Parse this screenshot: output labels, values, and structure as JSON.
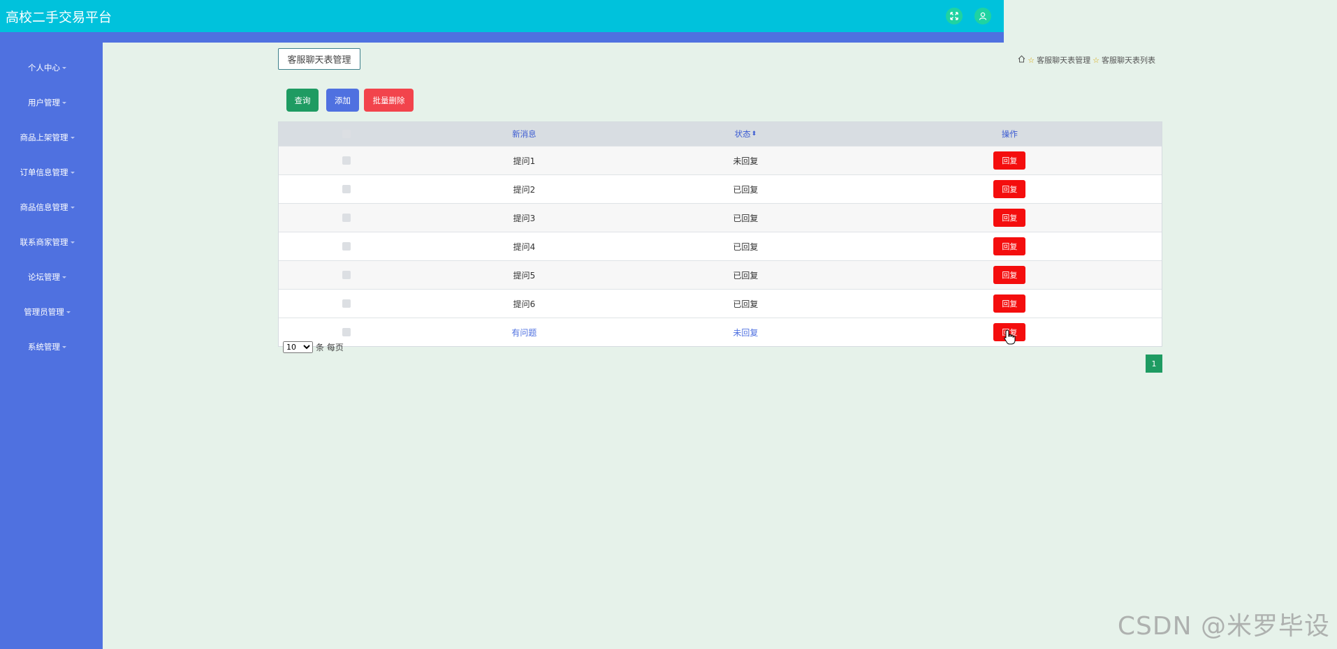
{
  "header": {
    "app_title": "高校二手交易平台",
    "icons": [
      "fullscreen-icon",
      "user-icon"
    ],
    "accent_color": "#00c2dc"
  },
  "sidebar": {
    "items": [
      {
        "label": "个人中心"
      },
      {
        "label": "用户管理"
      },
      {
        "label": "商品上架管理"
      },
      {
        "label": "订单信息管理"
      },
      {
        "label": "商品信息管理"
      },
      {
        "label": "联系商家管理"
      },
      {
        "label": "论坛管理"
      },
      {
        "label": "管理员管理"
      },
      {
        "label": "系统管理"
      }
    ],
    "bg_color": "#4f71e0"
  },
  "main": {
    "page_title": "客服聊天表管理",
    "breadcrumb": [
      "客服聊天表管理",
      "客服聊天表列表"
    ],
    "buttons": {
      "search": "查询",
      "add": "添加",
      "batch_delete": "批量删除"
    },
    "table": {
      "headers": [
        "新消息",
        "状态",
        "操作"
      ],
      "rows": [
        {
          "message": "提问1",
          "status": "未回复",
          "action": "回复"
        },
        {
          "message": "提问2",
          "status": "已回复",
          "action": "回复"
        },
        {
          "message": "提问3",
          "status": "已回复",
          "action": "回复"
        },
        {
          "message": "提问4",
          "status": "已回复",
          "action": "回复"
        },
        {
          "message": "提问5",
          "status": "已回复",
          "action": "回复"
        },
        {
          "message": "提问6",
          "status": "已回复",
          "action": "回复"
        },
        {
          "message": "有问题",
          "status": "未回复",
          "action": "回复"
        }
      ]
    },
    "pagination": {
      "page_size": "10",
      "page_size_suffix": "条 每页",
      "current_page": "1"
    }
  },
  "watermark": "CSDN @米罗毕设"
}
